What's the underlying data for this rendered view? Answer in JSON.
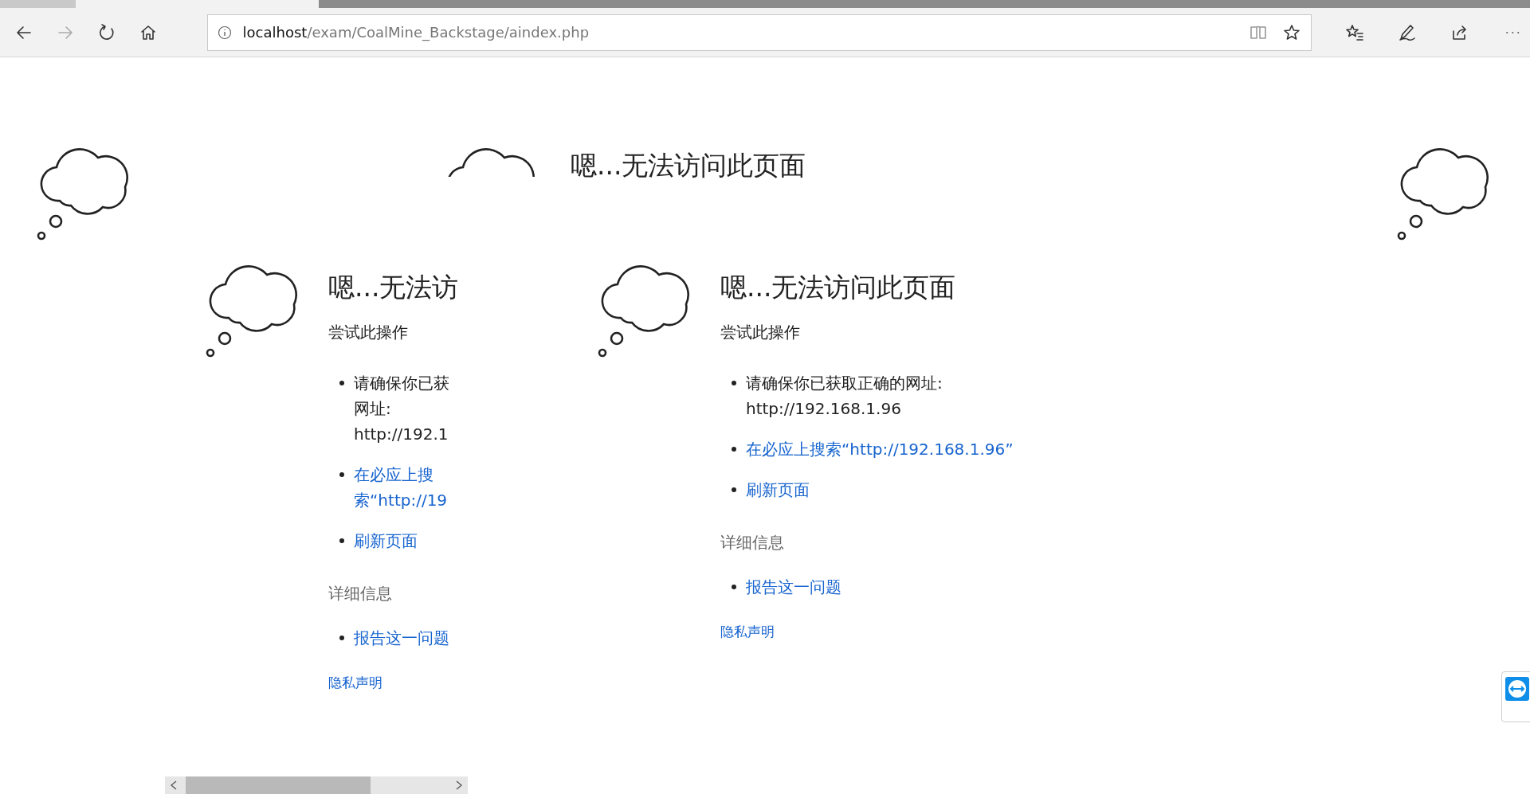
{
  "browser": {
    "back_disabled": false,
    "forward_disabled": true,
    "url_host": "localhost",
    "url_path": "/exam/CoalMine_Backstage/aindex.php"
  },
  "top_frame": {
    "heading": "嗯...无法访问此页面"
  },
  "left_frame": {
    "heading": "嗯...无法访",
    "subheading": "尝试此操作",
    "items": [
      {
        "kind": "text",
        "lines": [
          "请确保你已获",
          "网址:",
          "http://192.1"
        ]
      },
      {
        "kind": "link",
        "lines": [
          "在必应上搜",
          "索“http://19"
        ]
      },
      {
        "kind": "link",
        "lines": [
          "刷新页面"
        ]
      }
    ],
    "details_heading": "详细信息",
    "details_items": [
      {
        "kind": "link",
        "lines": [
          "报告这一问题"
        ]
      }
    ],
    "privacy_link": "隐私声明"
  },
  "right_frame": {
    "heading": "嗯...无法访问此页面",
    "subheading": "尝试此操作",
    "items": [
      {
        "kind": "text",
        "lines": [
          "请确保你已获取正确的网址:",
          "http://192.168.1.96"
        ]
      },
      {
        "kind": "link",
        "lines": [
          "在必应上搜索“http://192.168.1.96”"
        ]
      },
      {
        "kind": "link",
        "lines": [
          "刷新页面"
        ]
      }
    ],
    "details_heading": "详细信息",
    "details_items": [
      {
        "kind": "link",
        "lines": [
          "报告这一问题"
        ]
      }
    ],
    "privacy_link": "隐私声明"
  }
}
